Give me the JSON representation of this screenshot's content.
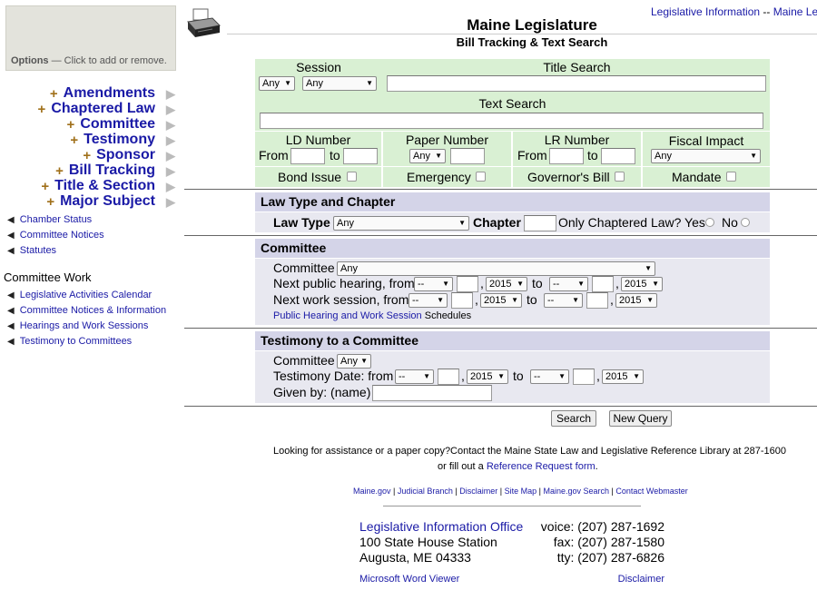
{
  "header": {
    "title": "Maine Legislature",
    "subtitle": "Bill Tracking & Text Search",
    "top_link_1": "Legislative Information",
    "top_sep": "--",
    "top_link_2": "Maine Legisl"
  },
  "options": {
    "label": "Options",
    "text": "— Click to add or remove."
  },
  "left_nav": {
    "big": [
      "Amendments",
      "Chaptered Law",
      "Committee",
      "Testimony",
      "Sponsor",
      "Bill Tracking",
      "Title & Section",
      "Major Subject"
    ],
    "small1": [
      "Chamber Status",
      "Committee Notices",
      "Statutes"
    ],
    "committee_work_heading": "Committee Work",
    "small2": [
      "Legislative Activities Calendar",
      "Committee Notices & Information",
      "Hearings and Work Sessions",
      "Testimony to Committees"
    ]
  },
  "form": {
    "session_label": "Session",
    "session_sel1": "Any",
    "session_sel2": "Any",
    "title_search_label": "Title Search",
    "text_search_label": "Text Search",
    "ld_label": "LD Number",
    "paper_label": "Paper Number",
    "lr_label": "LR Number",
    "fiscal_label": "Fiscal Impact",
    "from": "From",
    "to": "to",
    "paper_sel": "Any",
    "fiscal_sel": "Any",
    "bond_issue": "Bond Issue",
    "emergency": "Emergency",
    "governors_bill": "Governor's Bill",
    "mandate": "Mandate"
  },
  "law": {
    "heading": "Law Type and Chapter",
    "law_type_label": "Law Type",
    "law_type_sel": "Any",
    "chapter_label": "Chapter",
    "only_chaptered": "Only Chaptered Law? Yes",
    "no": "No"
  },
  "committee": {
    "heading": "Committee",
    "committee_label": "Committee",
    "committee_sel": "Any",
    "public_hearing": "Next public hearing, from",
    "work_session": "Next work session, from",
    "dash": "--",
    "year": "2015",
    "to": "to",
    "comma": ",",
    "schedules_link": "Public Hearing and Work Session",
    "schedules_text": "Schedules"
  },
  "testimony": {
    "heading": "Testimony to a Committee",
    "committee_label": "Committee",
    "committee_sel": "Any",
    "date_label": "Testimony Date: from",
    "given_by": "Given by: (name)"
  },
  "buttons": {
    "search": "Search",
    "new_query": "New Query"
  },
  "footer": {
    "assist": "Looking for assistance or a paper copy?Contact the Maine State Law and Legislative Reference Library at 287-1600",
    "fill_prefix": "or fill out a",
    "fill_link": "Reference Request form",
    "fill_suffix": ".",
    "links": [
      "Maine.gov",
      "Judicial Branch",
      "Disclaimer",
      "Site Map",
      "Maine.gov Search",
      "Contact Webmaster"
    ],
    "office": "Legislative Information Office",
    "street": "100 State House Station",
    "city": "Augusta, ME 04333",
    "voice": "voice: (207) 287-1692",
    "fax": "fax: (207) 287-1580",
    "tty": "tty: (207) 287-6826",
    "word_viewer": "Microsoft Word Viewer",
    "disclaimer": "Disclaimer"
  }
}
